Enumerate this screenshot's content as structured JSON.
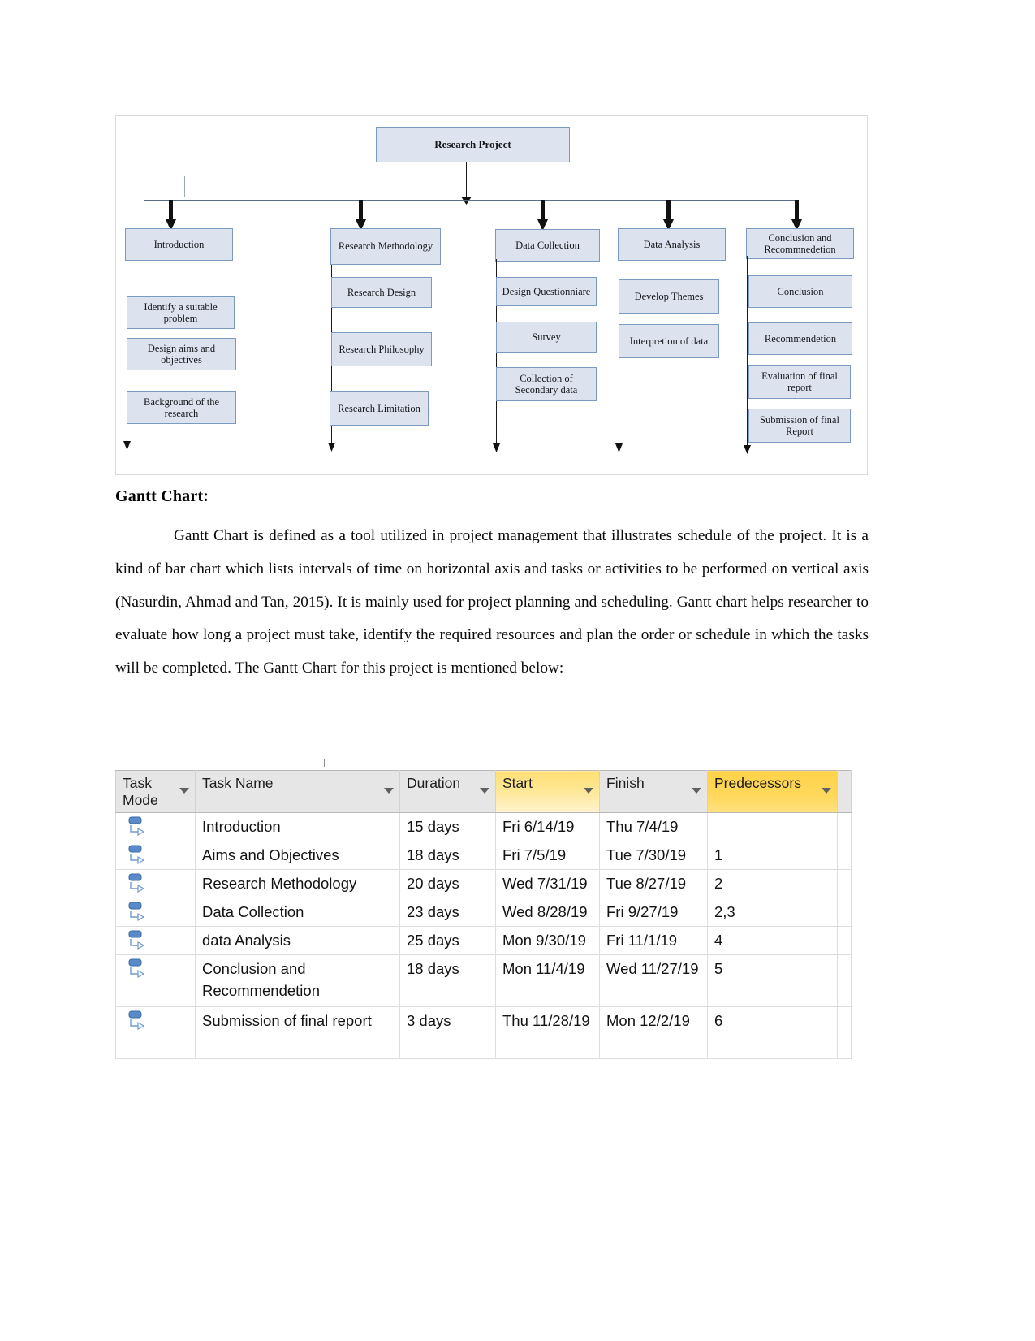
{
  "document": {
    "heading": "Gantt Chart:",
    "paragraph": "Gantt Chart is defined as a tool utilized in project management that illustrates schedule of the project. It is a kind of bar chart which lists intervals of time on horizontal axis and tasks or activities to be performed on vertical axis (Nasurdin, Ahmad and Tan, 2015). It is mainly used for project planning and scheduling. Gantt chart helps researcher to evaluate how long a project must take, identify the required resources and plan the order or schedule in which the tasks will be completed. The Gantt Chart for this project is  mentioned below:"
  },
  "diagram": {
    "root": "Research Project",
    "branches": [
      {
        "title": "Introduction",
        "children": [
          "Identify a suitable problem",
          "Design aims and objectives",
          "Background of the research"
        ]
      },
      {
        "title": "Research Methodology",
        "children": [
          "Research Design",
          "Research Philosophy",
          "Research Limitation"
        ]
      },
      {
        "title": "Data Collection",
        "children": [
          "Design Questionniare",
          "Survey",
          "Collection of Secondary data"
        ]
      },
      {
        "title": "Data Analysis",
        "children": [
          "Develop Themes",
          "Interpretion of data"
        ]
      },
      {
        "title": "Conclusion and Recommnedetion",
        "children": [
          "Conclusion",
          "Recommendetion",
          "Evaluation of final report",
          "Submission of final Report"
        ]
      }
    ],
    "colors": {
      "box_fill": "#dce3ef",
      "box_border": "#7a9ac0",
      "connector": "#5a6e86"
    }
  },
  "gantt_table": {
    "columns": [
      {
        "label": "Task\nMode",
        "key": "mode",
        "highlight": "none"
      },
      {
        "label": "Task Name",
        "key": "name",
        "highlight": "none"
      },
      {
        "label": "Duration",
        "key": "duration",
        "highlight": "none"
      },
      {
        "label": "Start",
        "key": "start",
        "highlight": "light"
      },
      {
        "label": "Finish",
        "key": "finish",
        "highlight": "none"
      },
      {
        "label": "Predecessors",
        "key": "predecessors",
        "highlight": "strong"
      }
    ],
    "rows": [
      {
        "name": "Introduction",
        "duration": "15 days",
        "start": "Fri 6/14/19",
        "finish": "Thu 7/4/19",
        "predecessors": ""
      },
      {
        "name": "Aims and Objectives",
        "duration": "18 days",
        "start": "Fri 7/5/19",
        "finish": "Tue 7/30/19",
        "predecessors": "1"
      },
      {
        "name": "Research Methodology",
        "duration": "20 days",
        "start": "Wed 7/31/19",
        "finish": "Tue 8/27/19",
        "predecessors": "2"
      },
      {
        "name": "Data Collection",
        "duration": "23 days",
        "start": "Wed 8/28/19",
        "finish": "Fri 9/27/19",
        "predecessors": "2,3"
      },
      {
        "name": "data Analysis",
        "duration": "25 days",
        "start": "Mon 9/30/19",
        "finish": "Fri 11/1/19",
        "predecessors": "4"
      },
      {
        "name": "Conclusion and Recommendetion",
        "duration": "18 days",
        "start": "Mon 11/4/19",
        "finish": "Wed 11/27/19",
        "predecessors": "5"
      },
      {
        "name": "Submission of final report",
        "duration": "3 days",
        "start": "Thu 11/28/19",
        "finish": "Mon 12/2/19",
        "predecessors": "6"
      }
    ],
    "colors": {
      "header_bg": "#e6e6e6",
      "start_highlight": "#ffe794",
      "predecessors_highlight": "#ffd85c",
      "task_mode_icon": "#4b7cc4"
    }
  },
  "chart_data": {
    "type": "table",
    "title": "Gantt Chart",
    "categories": [
      "Introduction",
      "Aims and Objectives",
      "Research Methodology",
      "Data Collection",
      "data Analysis",
      "Conclusion and Recommendetion",
      "Submission of final report"
    ],
    "values": [
      15,
      18,
      20,
      23,
      25,
      18,
      3
    ],
    "ylabel": "Duration (days)",
    "xlabel": "Task",
    "series": [
      {
        "name": "Duration (days)",
        "values": [
          15,
          18,
          20,
          23,
          25,
          18,
          3
        ]
      }
    ],
    "start_dates": [
      "Fri 6/14/19",
      "Fri 7/5/19",
      "Wed 7/31/19",
      "Wed 8/28/19",
      "Mon 9/30/19",
      "Mon 11/4/19",
      "Thu 11/28/19"
    ],
    "finish_dates": [
      "Thu 7/4/19",
      "Tue 7/30/19",
      "Tue 8/27/19",
      "Fri 9/27/19",
      "Fri 11/1/19",
      "Wed 11/27/19",
      "Mon 12/2/19"
    ],
    "predecessors": [
      "",
      "1",
      "2",
      "2,3",
      "4",
      "5",
      "6"
    ]
  }
}
